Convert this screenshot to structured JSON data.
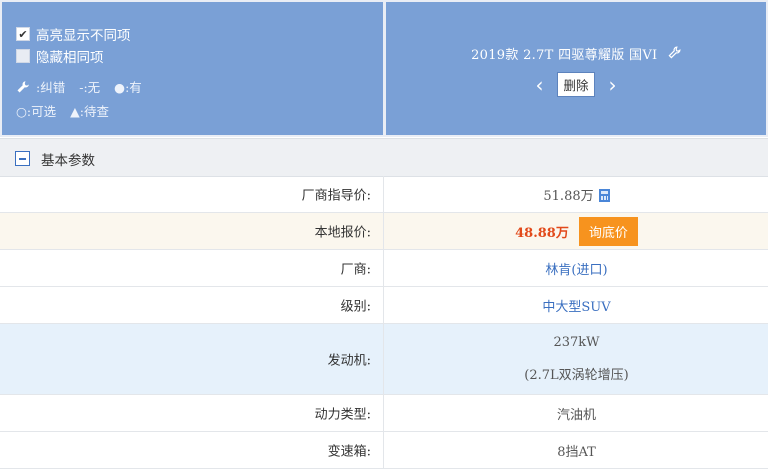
{
  "options": {
    "highlight_label": "高亮显示不同项",
    "highlight_checked": true,
    "hide_same_label": "隐藏相同项",
    "hide_same_checked": false
  },
  "legend": {
    "fix_label": ":纠错",
    "none_label": "-:无",
    "have_label": "●:有",
    "optional_label": "○:可选",
    "pending_label": "▲:待查"
  },
  "car": {
    "title": "2019款 2.7T 四驱尊耀版 国VI",
    "delete_label": "删除",
    "prev_arrow": "‹",
    "next_arrow": "›"
  },
  "section": {
    "title": "基本参数"
  },
  "rows": [
    {
      "label": "厂商指导价:",
      "value": "51.88万"
    },
    {
      "label": "本地报价:",
      "value": "48.88万",
      "button": "询底价"
    },
    {
      "label": "厂商:",
      "value": "林肯(进口)"
    },
    {
      "label": "级别:",
      "value": "中大型SUV"
    },
    {
      "label": "发动机:",
      "value": "237kW",
      "value2": "(2.7L双涡轮增压)"
    },
    {
      "label": "动力类型:",
      "value": "汽油机"
    },
    {
      "label": "变速箱:",
      "value": "8挡AT"
    }
  ],
  "colors": {
    "header_blue": "#7aa0d6",
    "price_red": "#e24a1b",
    "button_orange": "#f7931e",
    "link_blue": "#3a6fc0"
  }
}
